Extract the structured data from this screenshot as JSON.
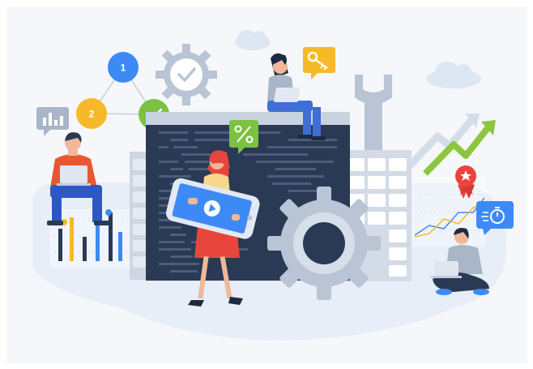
{
  "steps": [
    {
      "label": "1",
      "color": "#3d8af7"
    },
    {
      "label": "2",
      "color": "#f7b928"
    }
  ],
  "palette": {
    "background": "#f6f8fb",
    "blob": "#e8f0fb",
    "screen": "#2a3a55",
    "frame": "#c9d3e0",
    "gear": "#b9c4d4",
    "accent_blue": "#3d8af7",
    "accent_green": "#7cc242",
    "accent_orange": "#f7a928",
    "accent_red": "#e8463c",
    "arrow_green": "#8cc63f"
  },
  "icons": [
    "chart-icon",
    "gear-icon",
    "check-icon",
    "key-icon",
    "percent-icon",
    "play-icon",
    "wrench-icon",
    "medal-icon",
    "stopwatch-icon",
    "cloud-icon",
    "growth-arrow-icon",
    "laptop-icon"
  ]
}
